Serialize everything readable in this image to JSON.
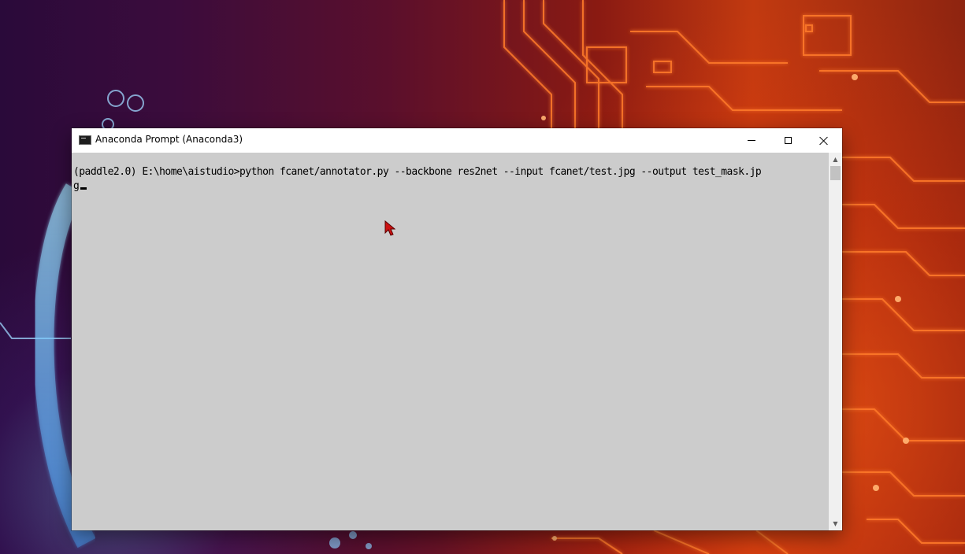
{
  "window": {
    "title": "Anaconda Prompt (Anaconda3)"
  },
  "console": {
    "line_1": "(paddle2.0) E:\\home\\aistudio>python fcanet/annotator.py --backbone res2net --input fcanet/test.jpg --output test_mask.jp",
    "line_2": "g"
  },
  "icons": {
    "app": "console-app-icon",
    "minimize": "minimize-icon",
    "maximize": "maximize-icon",
    "close": "close-icon",
    "scroll_up": "chevron-up-icon",
    "scroll_down": "chevron-down-icon",
    "pointer": "mouse-pointer-icon"
  },
  "glyphs": {
    "scroll_up": "▲",
    "scroll_down": "▼"
  },
  "colors": {
    "console_background": "#cccccc",
    "console_text": "#000000",
    "title_bar": "#ffffff",
    "pointer": "#cc1111"
  }
}
